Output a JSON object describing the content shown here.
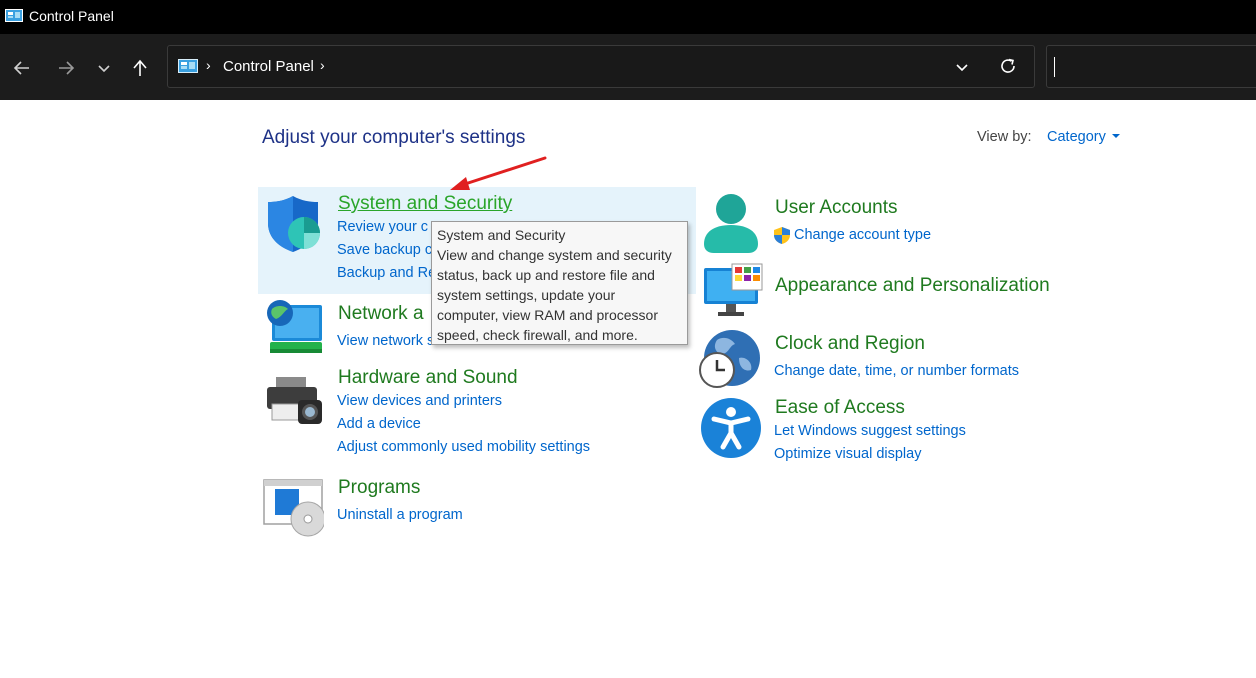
{
  "window": {
    "title": "Control Panel"
  },
  "address": {
    "crumb": "Control Panel",
    "search_value": ""
  },
  "main": {
    "heading": "Adjust your computer's settings",
    "view_by_label": "View by:",
    "view_by_value": "Category"
  },
  "categories": {
    "system_security": {
      "title": "System and Security",
      "links": [
        "Review your computer's status",
        "Save backup copies of your files with File History",
        "Backup and Restore (Windows 7)"
      ],
      "visible_links": [
        "Review your c",
        "Save backup c",
        "Backup and Re"
      ]
    },
    "network": {
      "title": "Network and Internet",
      "visible_title": "Network a",
      "visible_link": "View network status and tasks"
    },
    "hardware": {
      "title": "Hardware and Sound",
      "links": [
        "View devices and printers",
        "Add a device",
        "Adjust commonly used mobility settings"
      ]
    },
    "programs": {
      "title": "Programs",
      "links": [
        "Uninstall a program"
      ]
    },
    "user_accounts": {
      "title": "User Accounts",
      "links": [
        "Change account type"
      ]
    },
    "appearance": {
      "title": "Appearance and Personalization"
    },
    "clock": {
      "title": "Clock and Region",
      "links": [
        "Change date, time, or number formats"
      ]
    },
    "ease": {
      "title": "Ease of Access",
      "links": [
        "Let Windows suggest settings",
        "Optimize visual display"
      ]
    }
  },
  "tooltip": {
    "lines": [
      "System and Security",
      "View and change system and security",
      "status, back up and restore file and",
      "system settings, update your",
      "computer, view RAM and processor",
      "speed, check firewall, and more."
    ]
  },
  "colors": {
    "title_bar": "#000000",
    "nav_bar": "#1c1c1c",
    "heading": "#1e3287",
    "category_title": "#1f7a1f",
    "category_title_hover": "#2aa52a",
    "link": "#0066cc",
    "highlight": "#e5f3fb",
    "annotation_arrow": "#e02020"
  },
  "icons": [
    "control-panel-icon",
    "back-arrow-icon",
    "forward-arrow-icon",
    "recent-chevron-icon",
    "up-arrow-icon",
    "dropdown-chevron-icon",
    "refresh-icon",
    "shield-icon",
    "network-globe-icon",
    "printer-camera-icon",
    "programs-disc-icon",
    "user-icon",
    "uac-shield-icon",
    "monitor-palette-icon",
    "clock-globe-icon",
    "accessibility-icon"
  ]
}
